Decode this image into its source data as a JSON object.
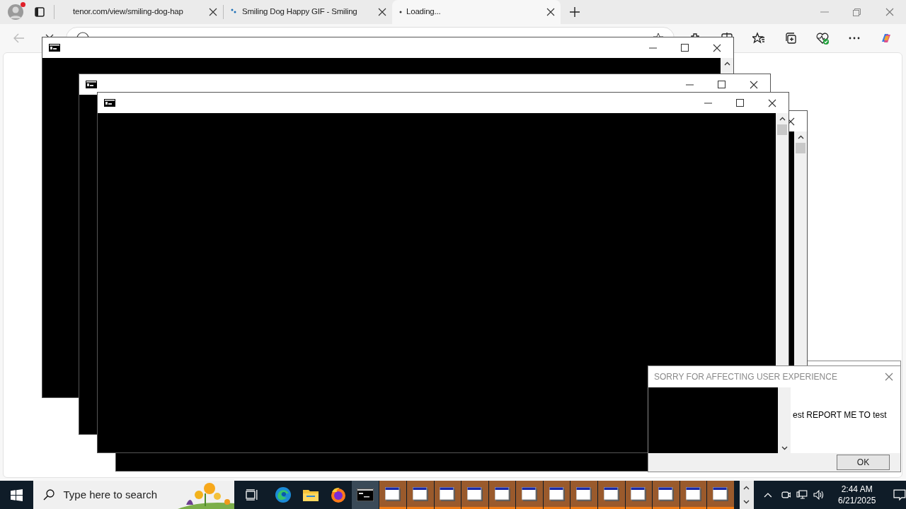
{
  "browser": {
    "tabs": [
      {
        "title": "tenor.com/view/smiling-dog-hap",
        "kind": "plain",
        "selected": false
      },
      {
        "title": "Smiling Dog Happy GIF - Smiling",
        "kind": "dots",
        "selected": false
      },
      {
        "title": "Loading...",
        "kind": "loading",
        "selected": true
      }
    ]
  },
  "dialog": {
    "title": "SORRY FOR AFFECTING USER EXPERIENCE",
    "message": "est REPORT ME TO test",
    "button": "OK"
  },
  "taskbar": {
    "search_placeholder": "Type here to search",
    "apps": [
      {
        "kind": "edge",
        "selected": false,
        "flashing": false
      },
      {
        "kind": "explorer",
        "selected": false,
        "flashing": false
      },
      {
        "kind": "firefox",
        "selected": false,
        "flashing": false
      },
      {
        "kind": "console",
        "selected": true,
        "flashing": false
      },
      {
        "kind": "window",
        "selected": false,
        "flashing": true
      },
      {
        "kind": "window",
        "selected": false,
        "flashing": true
      },
      {
        "kind": "window",
        "selected": false,
        "flashing": true
      },
      {
        "kind": "window",
        "selected": false,
        "flashing": true
      },
      {
        "kind": "window",
        "selected": false,
        "flashing": true
      },
      {
        "kind": "window",
        "selected": false,
        "flashing": true
      },
      {
        "kind": "window",
        "selected": false,
        "flashing": true
      },
      {
        "kind": "window",
        "selected": false,
        "flashing": true
      },
      {
        "kind": "window",
        "selected": false,
        "flashing": true
      },
      {
        "kind": "window",
        "selected": false,
        "flashing": true
      },
      {
        "kind": "window",
        "selected": false,
        "flashing": true
      },
      {
        "kind": "window",
        "selected": false,
        "flashing": true
      },
      {
        "kind": "window",
        "selected": false,
        "flashing": true
      }
    ],
    "time": "2:44 AM",
    "date": "6/21/2025"
  }
}
